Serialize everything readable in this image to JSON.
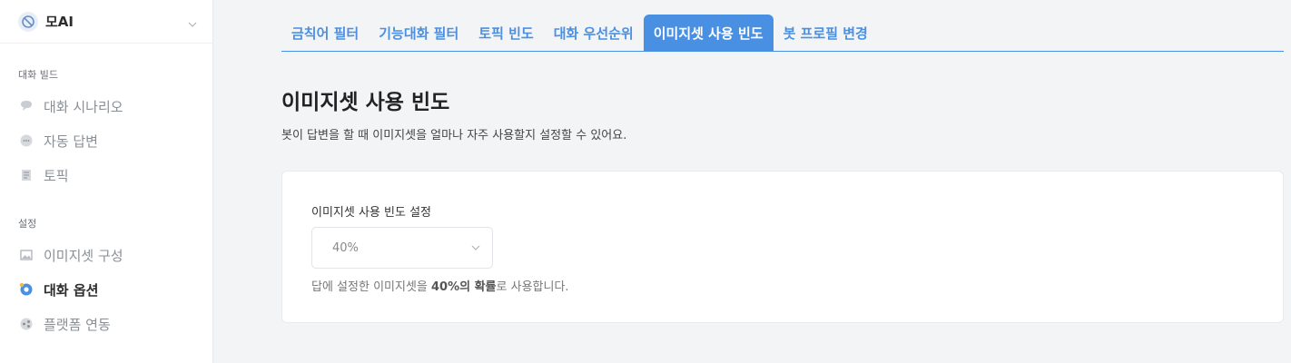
{
  "brand": {
    "name": "모AI"
  },
  "sidebar": {
    "sections": [
      {
        "label": "대화 빌드",
        "items": [
          {
            "label": "대화 시나리오",
            "icon": "chat-bubble-icon"
          },
          {
            "label": "자동 답변",
            "icon": "speech-dots-icon"
          },
          {
            "label": "토픽",
            "icon": "document-icon"
          }
        ]
      },
      {
        "label": "설정",
        "items": [
          {
            "label": "이미지셋 구성",
            "icon": "image-icon"
          },
          {
            "label": "대화 옵션",
            "icon": "gear-icon",
            "active": true
          },
          {
            "label": "플랫폼 연동",
            "icon": "share-icon"
          }
        ]
      }
    ]
  },
  "tabs": [
    {
      "label": "금칙어 필터"
    },
    {
      "label": "기능대화 필터"
    },
    {
      "label": "토픽 빈도"
    },
    {
      "label": "대화 우선순위"
    },
    {
      "label": "이미지셋 사용 빈도",
      "active": true
    },
    {
      "label": "봇 프로필 변경"
    }
  ],
  "page": {
    "title": "이미지셋 사용 빈도",
    "description": "봇이 답변을 할 때 이미지셋을 얼마나 자주 사용할지 설정할 수 있어요."
  },
  "settings": {
    "field_label": "이미지셋 사용 빈도 설정",
    "select_value": "40%",
    "hint_prefix": "답에 설정한 이미지셋을 ",
    "hint_bold": "40%의 확률",
    "hint_suffix": "로 사용합니다."
  },
  "colors": {
    "accent": "#4a90e2",
    "background": "#f3f4f6"
  }
}
